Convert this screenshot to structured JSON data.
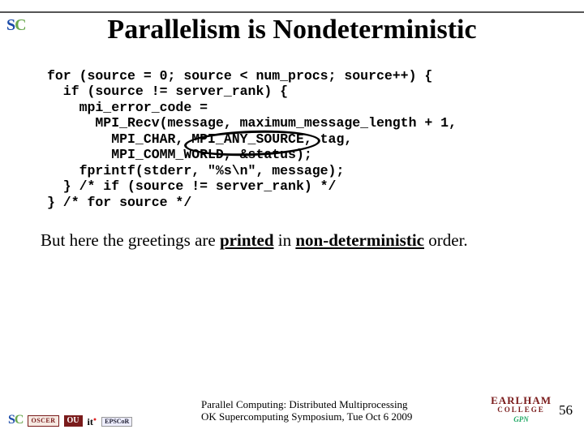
{
  "title": "Parallelism is Nondeterministic",
  "code": "for (source = 0; source < num_procs; source++) {\n  if (source != server_rank) {\n    mpi_error_code =\n      MPI_Recv(message, maximum_message_length + 1,\n        MPI_CHAR, MPI_ANY_SOURCE, tag,\n        MPI_COMM_WORLD, &status);\n    fprintf(stderr, \"%s\\n\", message);\n  } /* if (source != server_rank) */\n} /* for source */",
  "caption_pre": "But here the greetings are ",
  "caption_u1": "printed",
  "caption_mid": " in ",
  "caption_u2": "non-deterministic",
  "caption_post": " order.",
  "logos": {
    "sc_s": "S",
    "sc_c": "C",
    "oscer": "OSCER",
    "ou": "OU",
    "it": "it",
    "epscor": "EPSCoR"
  },
  "footer_line1": "Parallel Computing: Distributed Multiprocessing",
  "footer_line2": "OK Supercomputing Symposium, Tue Oct 6 2009",
  "earlham_name": "EARLHAM",
  "earlham_sub": "COLLEGE",
  "gpn": "GPN",
  "page": "56"
}
